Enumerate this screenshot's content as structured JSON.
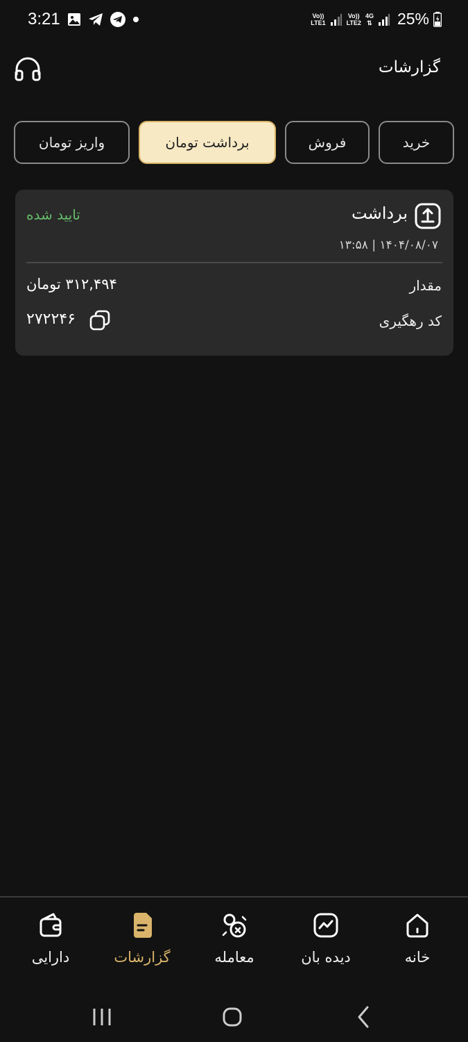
{
  "status_bar": {
    "time": "3:21",
    "net1_top": "Vo))",
    "net1_bottom": "LTE1",
    "net2_top": "Vo))",
    "net2_bottom": "LTE2",
    "net2_type": "4G",
    "battery": "25%"
  },
  "header": {
    "title": "گزارشات",
    "support_icon": "headphones-icon"
  },
  "tabs": [
    {
      "label": "خرید",
      "active": false
    },
    {
      "label": "فروش",
      "active": false
    },
    {
      "label": "برداشت تومان",
      "active": true
    },
    {
      "label": "واریز تومان",
      "active": false
    }
  ],
  "transaction": {
    "type": "برداشت",
    "type_icon": "upload-icon",
    "status": "تایید شده",
    "status_color": "#66bb6a",
    "date": "۱۴۰۴/۰۸/۰۷ | ۱۳:۵۸",
    "amount_label": "مقدار",
    "amount_value": "۳۱۲,۴۹۴ تومان",
    "tracking_label": "کد رهگیری",
    "tracking_value": "۲۷۲۲۴۶"
  },
  "bottom_nav": [
    {
      "label": "خانه",
      "icon": "home-icon",
      "active": false
    },
    {
      "label": "دیده بان",
      "icon": "watchlist-icon",
      "active": false
    },
    {
      "label": "معامله",
      "icon": "trade-icon",
      "active": false
    },
    {
      "label": "گزارشات",
      "icon": "report-icon",
      "active": true
    },
    {
      "label": "دارایی",
      "icon": "wallet-icon",
      "active": false
    }
  ],
  "colors": {
    "background": "#121212",
    "card": "#2a2a2a",
    "accent": "#d9b46a",
    "active_tab_bg": "#f7e9c4"
  }
}
